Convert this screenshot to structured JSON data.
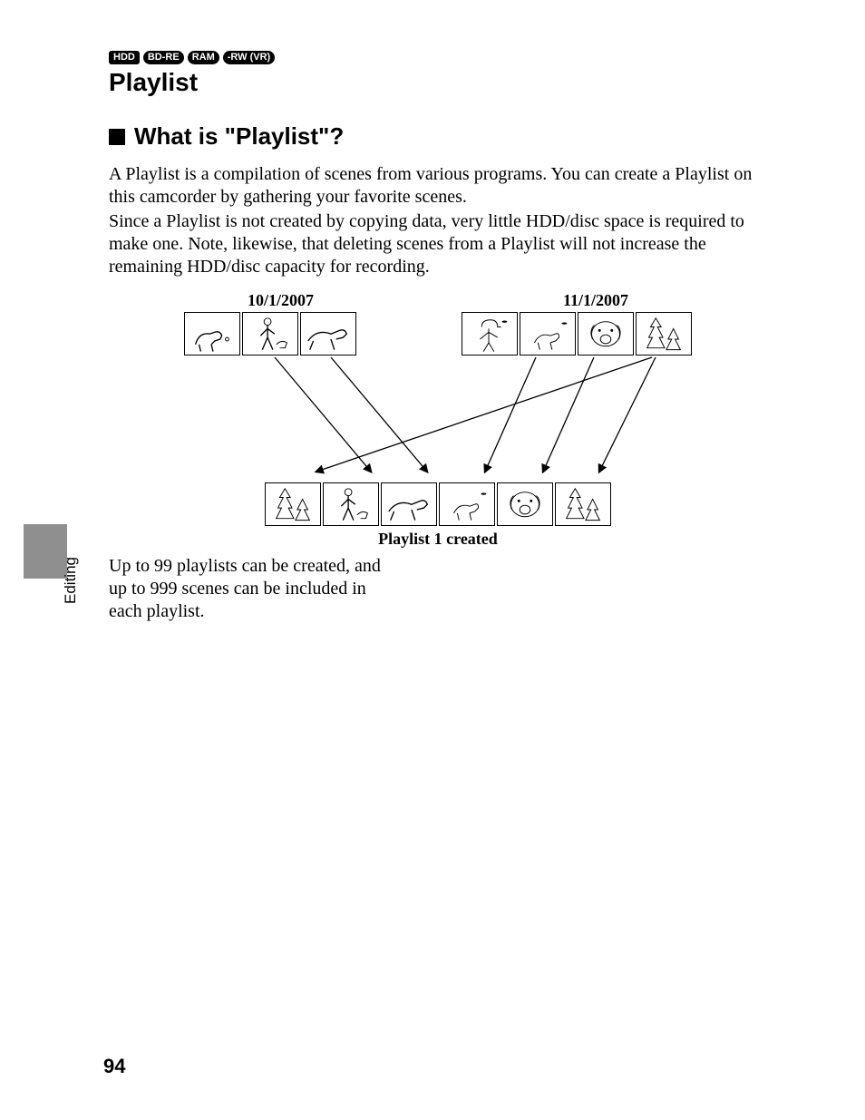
{
  "badges": {
    "hdd": "HDD",
    "bdre": "BD-RE",
    "ram": "RAM",
    "rwvr": "-RW (VR)"
  },
  "title": "Playlist",
  "heading": "What is \"Playlist\"?",
  "para1": "A Playlist is a compilation of scenes from various programs. You can create a Playlist on this camcorder by gathering your favorite scenes.",
  "para2": "Since a Playlist is not created by copying data, very little HDD/disc space is required to make one. Note, likewise, that deleting scenes from a Playlist will not increase the remaining HDD/disc capacity for recording.",
  "diagram": {
    "date_left": "10/1/2007",
    "date_right": "11/1/2007",
    "caption": "Playlist 1 created"
  },
  "limits_text": "Up to 99 playlists can be created, and up to 999 scenes can be included in each playlist.",
  "side_label": "Editing",
  "page_number": "94"
}
